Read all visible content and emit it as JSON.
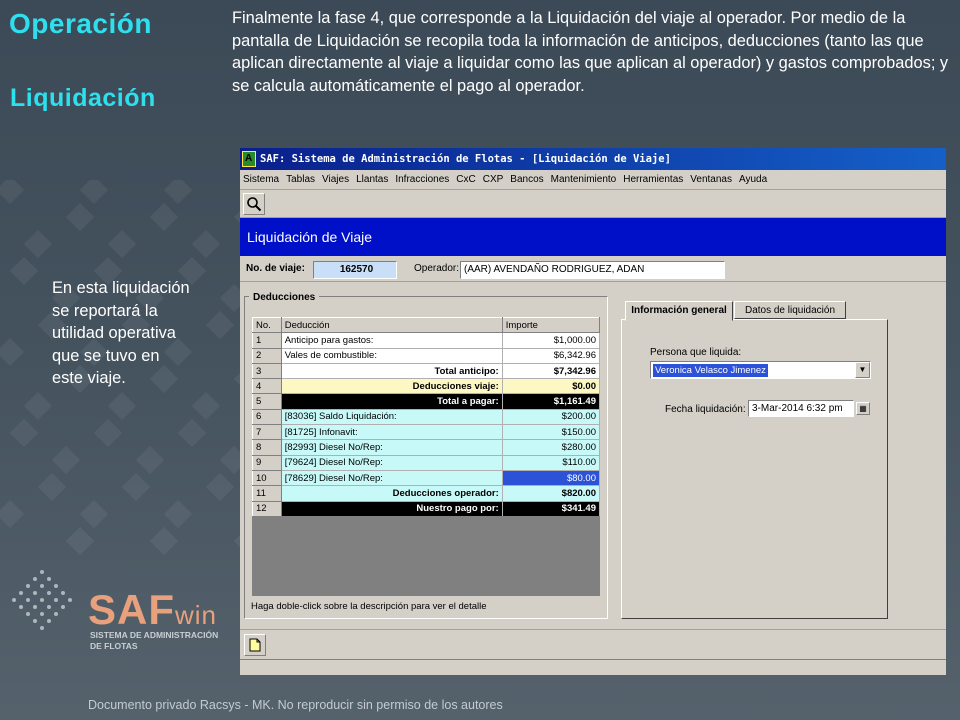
{
  "slide": {
    "title": "Operación",
    "subtitle": "Liquidación",
    "intro": "Finalmente la fase 4, que corresponde a la Liquidación del viaje al operador. Por medio de la pantalla de Liquidación se recopila toda la información de anticipos, deducciones (tanto las que aplican directamente al viaje a liquidar como las que aplican al operador) y gastos comprobados; y se calcula automáticamente el pago al operador.",
    "side_note": "En esta liquidación se reportará la utilidad operativa que se tuvo en este viaje.",
    "footer": "Documento privado Racsys - MK. No reproducir sin permiso de los autores",
    "logo": {
      "saf": "SAF",
      "win": "win",
      "sub1": "SISTEMA DE ADMINISTRACIÓN",
      "sub2": "DE FLOTAS"
    },
    "colors": {
      "accent": "#2ee0ee",
      "background": "#45535f",
      "logo": "#e9a07c"
    }
  },
  "window": {
    "title": "SAF: Sistema de Administración de Flotas - [Liquidación de Viaje]",
    "menu": [
      "Sistema",
      "Tablas",
      "Viajes",
      "Llantas",
      "Infracciones",
      "CxC",
      "CXP",
      "Bancos",
      "Mantenimiento",
      "Herramientas",
      "Ventanas",
      "Ayuda"
    ],
    "toolbar_icon": "search-icon",
    "header": "Liquidación de Viaje",
    "trip_label": "No. de viaje:",
    "trip_value": "162570",
    "operator_label": "Operador:",
    "operator_value": "(AAR) AVENDAÑO RODRIGUEZ, ADAN",
    "deductions_group": "Deducciones",
    "table": {
      "headers": [
        "No.",
        "Deducción",
        "Importe"
      ],
      "rows": [
        {
          "no": "1",
          "desc": "Anticipo para gastos:",
          "amount": "$1,000.00",
          "style": "white"
        },
        {
          "no": "2",
          "desc": "Vales de combustible:",
          "amount": "$6,342.96",
          "style": "white"
        },
        {
          "no": "3",
          "desc": "Total anticipo:",
          "amount": "$7,342.96",
          "style": "white-total"
        },
        {
          "no": "4",
          "desc": "Deducciones viaje:",
          "amount": "$0.00",
          "style": "yellow"
        },
        {
          "no": "5",
          "desc": "Total a pagar:",
          "amount": "$1,161.49",
          "style": "black"
        },
        {
          "no": "6",
          "desc": "[83036] Saldo Liquidación:",
          "amount": "$200.00",
          "style": "cyan"
        },
        {
          "no": "7",
          "desc": "[81725] Infonavit:",
          "amount": "$150.00",
          "style": "cyan"
        },
        {
          "no": "8",
          "desc": "[82993] Diesel No/Rep:",
          "amount": "$280.00",
          "style": "cyan"
        },
        {
          "no": "9",
          "desc": "[79624] Diesel No/Rep:",
          "amount": "$110.00",
          "style": "cyan"
        },
        {
          "no": "10",
          "desc": "[78629] Diesel No/Rep:",
          "amount": "$80.00",
          "style": "cyan-sel"
        },
        {
          "no": "11",
          "desc": "Deducciones operador:",
          "amount": "$820.00",
          "style": "cyan-total"
        },
        {
          "no": "12",
          "desc": "Nuestro pago por:",
          "amount": "$341.49",
          "style": "black"
        }
      ]
    },
    "hint": "Haga doble-click sobre la descripción para ver el detalle",
    "tabs": [
      "Información general",
      "Datos de liquidación"
    ],
    "person_label": "Persona que liquida:",
    "person_value": "Veronica Velasco Jimenez",
    "date_label": "Fecha liquidación:",
    "date_value": "3-Mar-2014 6:32 pm"
  }
}
